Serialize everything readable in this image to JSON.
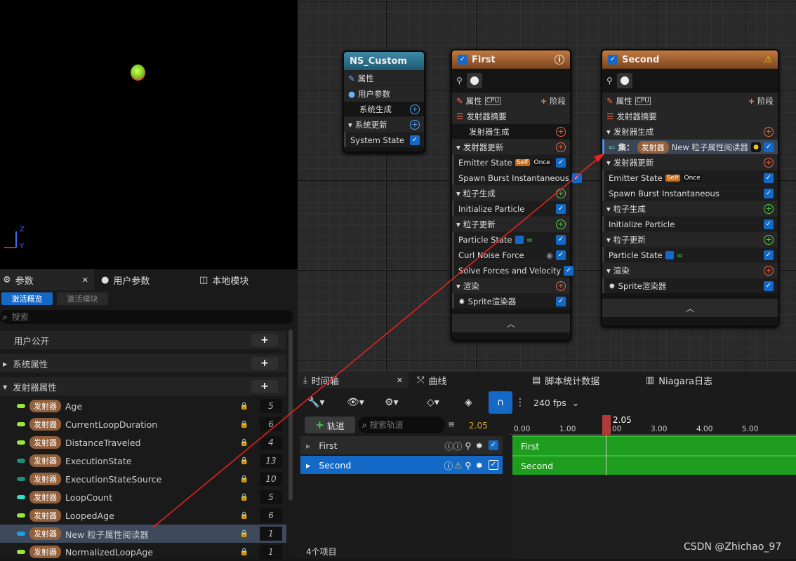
{
  "viewport": {
    "axis_z": "Z",
    "axis_y": "Y"
  },
  "nodes": {
    "system": {
      "title": "NS_Custom",
      "rows": [
        "属性",
        "用户参数",
        "系统生成",
        "系统更新",
        "System State"
      ]
    },
    "first": {
      "title": "First",
      "attr": "属性",
      "cpu": "CPU",
      "stage": "阶段",
      "summary": "发射器摘要",
      "rows": [
        "发射器生成",
        "发射器更新",
        "Emitter State",
        "Spawn Burst Instantaneous",
        "粒子生成",
        "Initialize Particle",
        "粒子更新",
        "Particle State",
        "Curl Noise Force",
        "Solve Forces and Velocity",
        "渲染",
        "Sprite渲染器"
      ],
      "self": "Self",
      "once": "Once"
    },
    "second": {
      "title": "Second",
      "attr": "属性",
      "cpu": "CPU",
      "stage": "阶段",
      "summary": "发射器摘要",
      "rows": [
        "发射器生成",
        "发射器更新",
        "Emitter State",
        "Spawn Burst Instantaneous",
        "粒子生成",
        "Initialize Particle",
        "粒子更新",
        "Particle State",
        "渲染",
        "Sprite渲染器"
      ],
      "set_label": "集：",
      "set_pill": "发射器",
      "set_value": "New 粒子属性阅读器",
      "self": "Self",
      "once": "Once"
    }
  },
  "params": {
    "tabs": [
      "参数",
      "用户参数",
      "本地模块"
    ],
    "subtabs": [
      "激活概览",
      "激活模块"
    ],
    "search_placeholder": "搜索",
    "sections": [
      "用户公开",
      "系统属性",
      "发射器属性"
    ],
    "pill": "发射器",
    "items": [
      {
        "name": "Age",
        "value": "5",
        "color": "#9be63a"
      },
      {
        "name": "CurrentLoopDuration",
        "value": "6",
        "color": "#9be63a"
      },
      {
        "name": "DistanceTraveled",
        "value": "4",
        "color": "#9be63a"
      },
      {
        "name": "ExecutionState",
        "value": "13",
        "color": "#1b8f7a"
      },
      {
        "name": "ExecutionStateSource",
        "value": "10",
        "color": "#1b8f7a"
      },
      {
        "name": "LoopCount",
        "value": "5",
        "color": "#33e0c0"
      },
      {
        "name": "LoopedAge",
        "value": "6",
        "color": "#9be63a"
      },
      {
        "name": "New 粒子属性阅读器",
        "value": "1",
        "color": "#1aa3e8"
      },
      {
        "name": "NormalizedLoopAge",
        "value": "1",
        "color": "#9be63a"
      }
    ]
  },
  "timeline": {
    "tabs": [
      "时间轴",
      "曲线",
      "脚本统计数据",
      "Niagara日志"
    ],
    "fps": "240 fps",
    "add_track": "轨道",
    "search_placeholder": "搜索轨道",
    "time": "2.05",
    "ticks": [
      "0.00",
      "1.00",
      "2.00",
      "3.00",
      "4.00",
      "5.00"
    ],
    "tracks": [
      "First",
      "Second"
    ],
    "footer": "4个项目"
  },
  "watermark": "CSDN @Zhichao_97"
}
